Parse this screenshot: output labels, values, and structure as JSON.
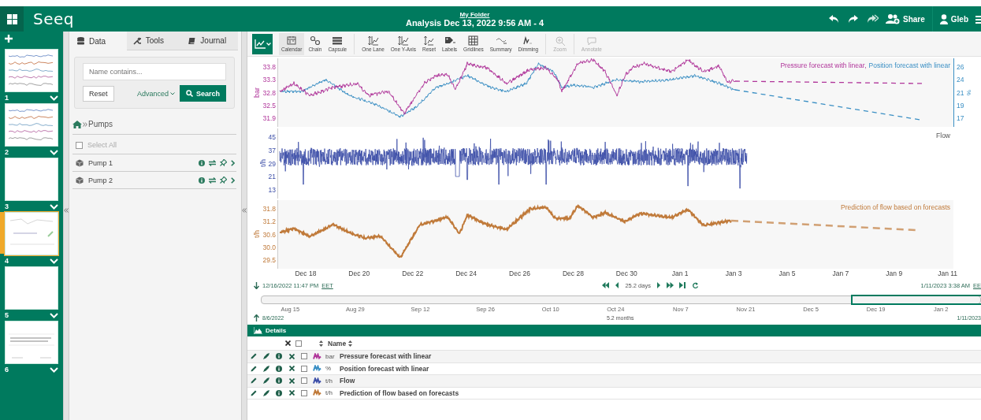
{
  "topbar": {
    "app_name": "Seeq",
    "folder": "My Folder",
    "title": "Analysis Dec 13, 2022 9:56 AM - 4",
    "share": "Share",
    "user": "Gleb"
  },
  "worksheets": [
    {
      "number": "1",
      "selected": false,
      "kind": "trend"
    },
    {
      "number": "2",
      "selected": false,
      "kind": "trend"
    },
    {
      "number": "3",
      "selected": false,
      "kind": "blank"
    },
    {
      "number": "4",
      "selected": true,
      "kind": "sketch"
    },
    {
      "number": "5",
      "selected": false,
      "kind": "blank"
    },
    {
      "number": "6",
      "selected": false,
      "kind": "doc"
    }
  ],
  "panel": {
    "tabs": [
      {
        "label": "Data",
        "selected": true
      },
      {
        "label": "Tools",
        "selected": false
      },
      {
        "label": "Journal",
        "selected": false
      }
    ],
    "search": {
      "placeholder": "Name contains...",
      "reset": "Reset",
      "advanced": "Advanced",
      "button": "Search"
    },
    "breadcrumb": "Pumps",
    "select_all": {
      "label": "Select All",
      "checked": false
    },
    "items": [
      "Pump 1",
      "Pump 2"
    ]
  },
  "toolbar": [
    {
      "label": "Calendar",
      "selected": true,
      "disabled": false
    },
    {
      "label": "Chain",
      "selected": false,
      "disabled": false
    },
    {
      "label": "Capsule",
      "selected": false,
      "disabled": false
    },
    {
      "label": "One Lane",
      "selected": false,
      "disabled": false
    },
    {
      "label": "One Y-Axis",
      "selected": false,
      "disabled": false
    },
    {
      "label": "Reset",
      "selected": false,
      "disabled": false
    },
    {
      "label": "Labels",
      "selected": false,
      "disabled": false
    },
    {
      "label": "Gridlines",
      "selected": false,
      "disabled": false
    },
    {
      "label": "Summary",
      "selected": false,
      "disabled": false
    },
    {
      "label": "Dimming",
      "selected": false,
      "disabled": false
    },
    {
      "label": "Zoom",
      "selected": false,
      "disabled": true
    },
    {
      "label": "Annotate",
      "selected": false,
      "disabled": true
    }
  ],
  "lanes": [
    {
      "axis_label": "bar",
      "ticks": [
        "33.8",
        "33.3",
        "32.8",
        "32.5",
        "31.9"
      ],
      "right_axis_label": "%",
      "right_ticks": [
        "26",
        "24",
        "21",
        "19",
        "17"
      ],
      "legend": [
        "Pressure forecast with linear,",
        "Position forecast with linear"
      ]
    },
    {
      "axis_label": "t/h",
      "ticks": [
        "45",
        "37",
        "29",
        "21",
        "13"
      ],
      "legend": [
        "Flow"
      ]
    },
    {
      "axis_label": "t/h",
      "ticks": [
        "31.8",
        "31.2",
        "30.6",
        "30.0",
        "29.5"
      ],
      "legend": [
        "Prediction of flow based on forecasts"
      ]
    }
  ],
  "x_ticks": [
    "Dec 18",
    "Dec 20",
    "Dec 22",
    "Dec 24",
    "Dec 26",
    "Dec 28",
    "Dec 30",
    "Jan 1",
    "Jan 3",
    "Jan 5",
    "Jan 7",
    "Jan 9",
    "Jan 11"
  ],
  "range": {
    "start": "12/16/2022 11:47 PM",
    "start_zone": "EET",
    "duration": "25.2 days",
    "end": "1/11/2023 3:38 AM",
    "end_zone": "EE"
  },
  "overview": {
    "ticks": [
      "Aug 15",
      "Aug 29",
      "Sep 12",
      "Sep 26",
      "Oct 10",
      "Oct 24",
      "Nov 7",
      "Nov 21",
      "Dec 5",
      "Dec 19",
      "Jan 2"
    ],
    "start": "8/6/2022",
    "duration": "5.2 months",
    "end": "1/11/2023"
  },
  "details": {
    "title": "Details",
    "name_header": "Name",
    "all_checked": false,
    "rows": [
      {
        "unit": "bar",
        "name": "Pressure forecast with linear",
        "color": "#b0359a",
        "checked": false
      },
      {
        "unit": "%",
        "name": "Position forecast with linear",
        "color": "#3a8fc4",
        "checked": false
      },
      {
        "unit": "t/h",
        "name": "Flow",
        "color": "#3d4fa8",
        "checked": false
      },
      {
        "unit": "t/h",
        "name": "Prediction of flow based on forecasts",
        "color": "#c07a3a",
        "checked": false
      }
    ]
  }
}
